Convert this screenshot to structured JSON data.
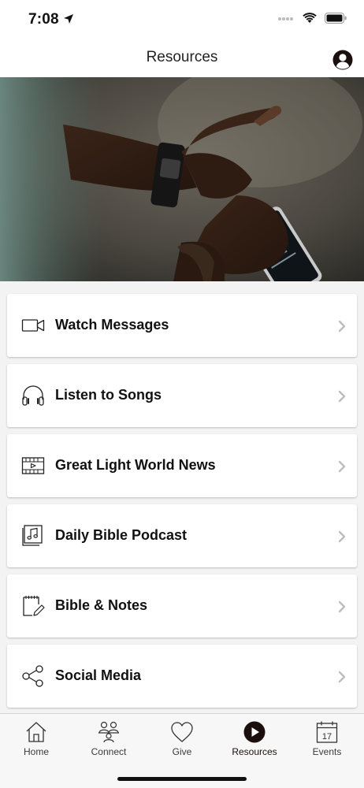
{
  "status": {
    "time": "7:08"
  },
  "nav": {
    "title": "Resources"
  },
  "colors": {
    "accent": "#1a0f0d",
    "row_bg": "#ffffff",
    "list_bg": "#f3f3f3"
  },
  "list": {
    "items": [
      {
        "label": "Watch Messages",
        "icon": "video-camera-icon"
      },
      {
        "label": "Listen to Songs",
        "icon": "headphones-icon"
      },
      {
        "label": "Great Light World News",
        "icon": "film-strip-icon"
      },
      {
        "label": "Daily Bible Podcast",
        "icon": "music-note-icon"
      },
      {
        "label": "Bible & Notes",
        "icon": "notepad-pencil-icon"
      },
      {
        "label": "Social Media",
        "icon": "share-icon"
      }
    ]
  },
  "tabbar": {
    "tabs": [
      {
        "label": "Home",
        "icon": "home-icon",
        "active": false
      },
      {
        "label": "Connect",
        "icon": "people-icon",
        "active": false
      },
      {
        "label": "Give",
        "icon": "heart-icon",
        "active": false
      },
      {
        "label": "Resources",
        "icon": "play-circle-icon",
        "active": true
      },
      {
        "label": "Events",
        "icon": "calendar-icon",
        "active": false,
        "date": "17"
      }
    ]
  }
}
